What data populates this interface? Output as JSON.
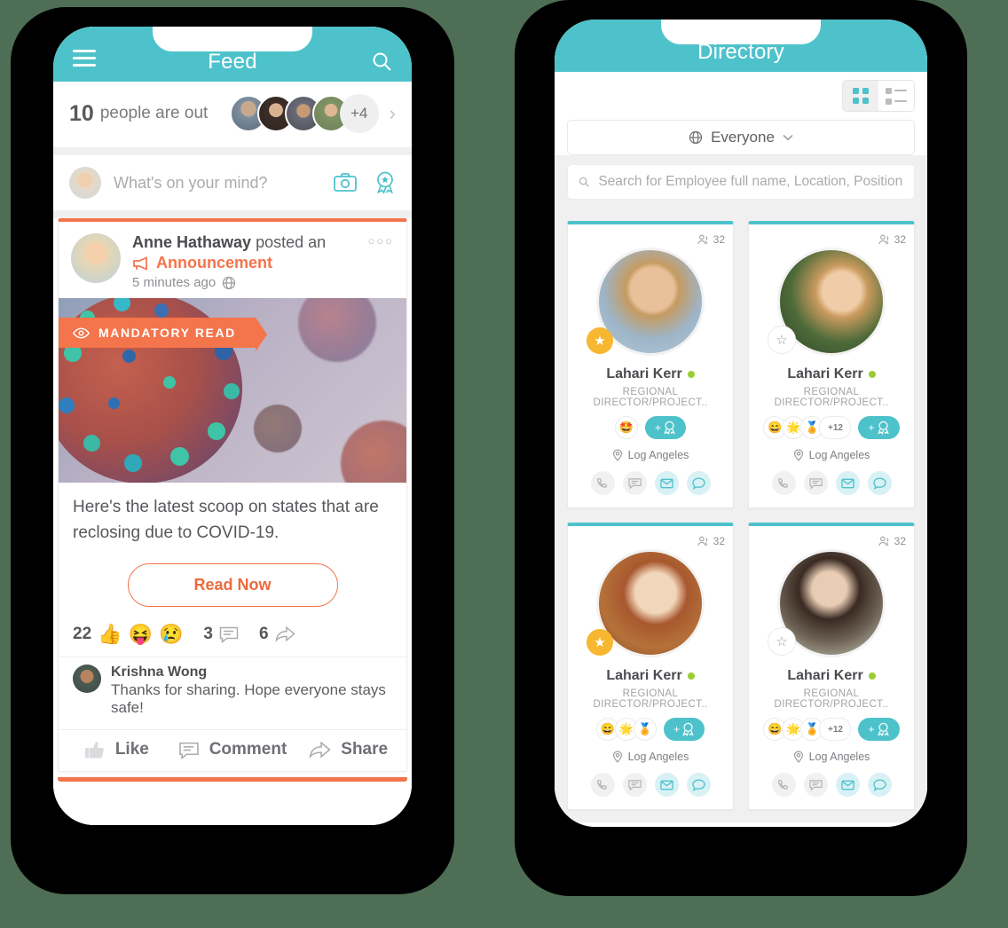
{
  "theme": {
    "teal": "#4EC2CB",
    "orange": "#F4744B",
    "orange_text": "#ED6A3C",
    "yellow": "#F7B731",
    "online": "#9ACD32"
  },
  "feed_phone": {
    "header": {
      "title": "Feed",
      "menu_icon": "hamburger-menu-icon",
      "search_icon": "search-icon"
    },
    "out_banner": {
      "count": "10",
      "text": "people are out",
      "more": "+4",
      "chevron": "chevron-right-icon"
    },
    "compose": {
      "placeholder": "What's on your mind?",
      "camera_icon": "camera-icon",
      "badge_icon": "award-badge-icon"
    },
    "post": {
      "author": "Anne Hathaway",
      "action": "posted an",
      "type": "Announcement",
      "type_icon": "megaphone-icon",
      "time": "5 minutes ago",
      "privacy_icon": "globe-icon",
      "more_icon": "ellipsis-icon",
      "banner_label": "MANDATORY READ",
      "banner_icon": "eye-icon",
      "body": "Here's the latest scoop on states that are reclosing due to COVID-19.",
      "cta": "Read Now",
      "reaction_count": "22",
      "reactions": [
        "👍",
        "😝",
        "😢"
      ],
      "comment_count": "3",
      "comment_icon": "comment-icon",
      "share_count": "6",
      "share_icon": "share-icon"
    },
    "comment": {
      "author": "Krishna Wong",
      "text": "Thanks for sharing. Hope everyone stays safe!"
    },
    "actions": [
      {
        "label": "Like",
        "icon": "thumbs-up-icon"
      },
      {
        "label": "Comment",
        "icon": "comment-icon"
      },
      {
        "label": "Share",
        "icon": "share-icon"
      }
    ]
  },
  "directory_phone": {
    "header": {
      "title": "Directory"
    },
    "view_toggle": {
      "grid": "grid-view-icon",
      "list": "list-view-icon",
      "active": "grid"
    },
    "audience": {
      "label": "Everyone",
      "icon": "globe-icon",
      "chevron": "chevron-down-icon"
    },
    "search": {
      "placeholder": "Search for Employee full name, Location, Position, Department a",
      "icon": "search-icon"
    },
    "cards": [
      {
        "name": "Lahari Kerr",
        "role": "REGIONAL DIRECTOR/PROJECT..",
        "location": "Log Angeles",
        "connections": "32",
        "starred": true,
        "online": true,
        "badges": [
          "🤩"
        ],
        "badge_more": "",
        "add_label": "+"
      },
      {
        "name": "Lahari Kerr",
        "role": "REGIONAL DIRECTOR/PROJECT..",
        "location": "Log Angeles",
        "connections": "32",
        "starred": false,
        "online": true,
        "badges": [
          "😄",
          "🌟",
          "🏅"
        ],
        "badge_more": "+12",
        "add_label": "+"
      },
      {
        "name": "Lahari Kerr",
        "role": "REGIONAL DIRECTOR/PROJECT..",
        "location": "Log Angeles",
        "connections": "32",
        "starred": true,
        "online": true,
        "badges": [
          "😄",
          "🌟",
          "🏅"
        ],
        "badge_more": "",
        "add_label": "+"
      },
      {
        "name": "Lahari Kerr",
        "role": "REGIONAL DIRECTOR/PROJECT..",
        "location": "Log Angeles",
        "connections": "32",
        "starred": false,
        "online": true,
        "badges": [
          "😄",
          "🌟",
          "🏅"
        ],
        "badge_more": "+12",
        "add_label": "+"
      }
    ],
    "card_icons": {
      "connections": "people-icon",
      "location": "pin-icon",
      "phone": "phone-icon",
      "chat": "chat-bubble-icon",
      "email": "envelope-icon",
      "message": "message-icon",
      "add": "add-badge-icon"
    }
  }
}
